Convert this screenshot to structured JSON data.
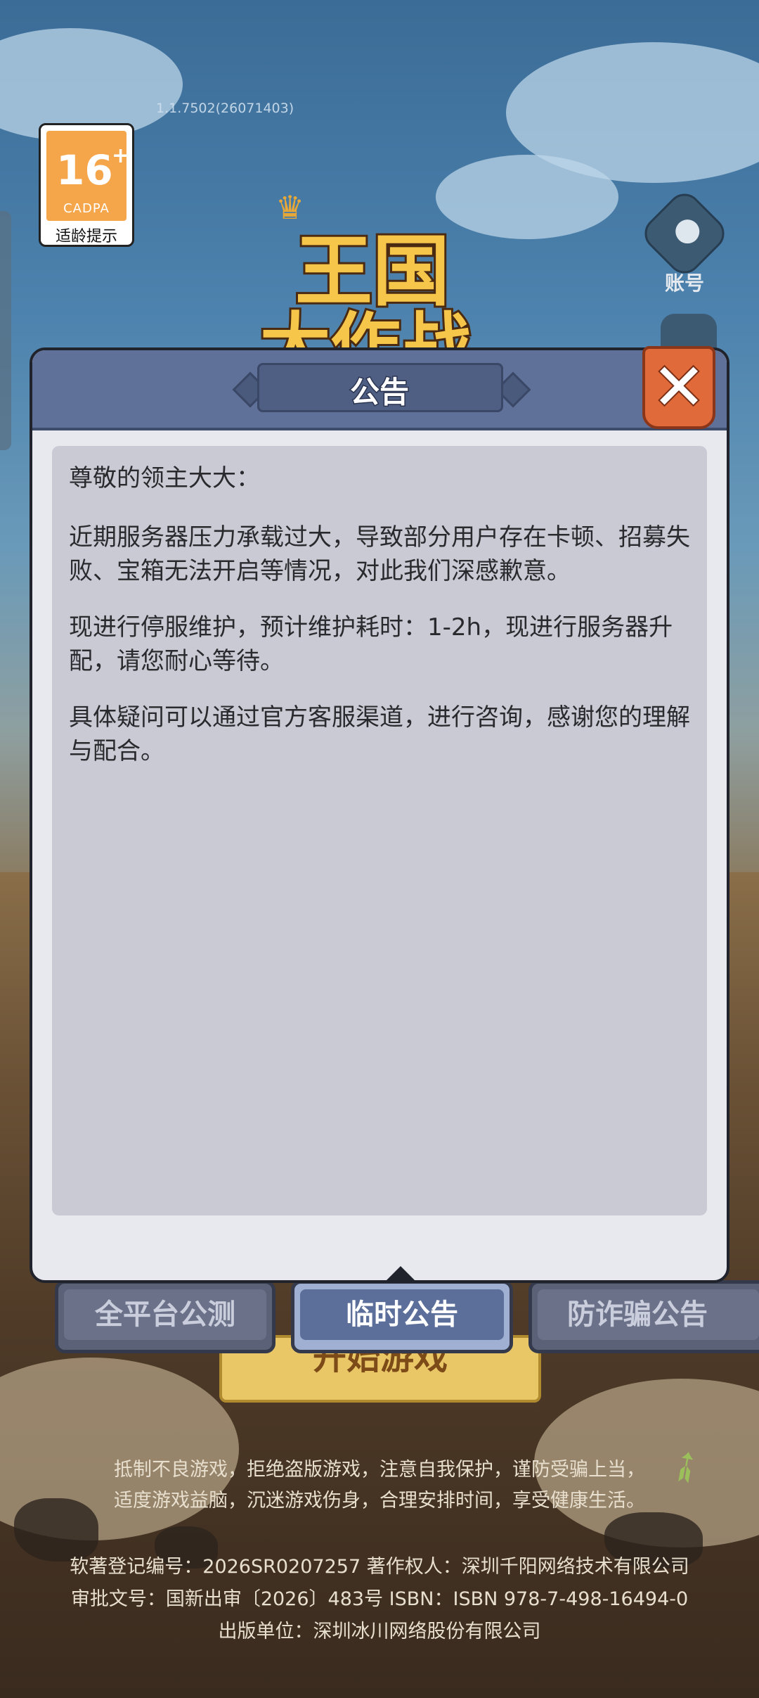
{
  "version": "1.1.7502(26071403)",
  "age_rating": {
    "number": "16",
    "plus": "+",
    "org": "CADPA",
    "label": "适龄提示"
  },
  "logo": {
    "line1": "王国",
    "line2": "大作战"
  },
  "account": {
    "label": "账号"
  },
  "modal": {
    "title": "公告",
    "paragraphs": [
      "尊敬的领主大大：",
      "近期服务器压力承载过大，导致部分用户存在卡顿、招募失败、宝箱无法开启等情况，对此我们深感歉意。",
      "现进行停服维护，预计维护耗时：1-2h，现进行服务器升配，请您耐心等待。",
      "具体疑问可以通过官方客服渠道，进行咨询，感谢您的理解与配合。"
    ]
  },
  "tabs": [
    {
      "label": "全平台公测",
      "active": false
    },
    {
      "label": "临时公告",
      "active": true
    },
    {
      "label": "防诈骗公告",
      "active": false
    }
  ],
  "start_button": {
    "label": "开始游戏"
  },
  "health_notice": [
    "抵制不良游戏，拒绝盗版游戏，注意自我保护，谨防受骗上当，",
    "适度游戏益脑，沉迷游戏伤身，合理安排时间，享受健康生活。"
  ],
  "legal": [
    "软著登记编号：2026SR0207257 著作权人：深圳千阳网络技术有限公司",
    "审批文号：国新出审〔2026〕483号 ISBN：ISBN 978-7-498-16494-0",
    "出版单位：深圳冰川网络股份有限公司"
  ]
}
